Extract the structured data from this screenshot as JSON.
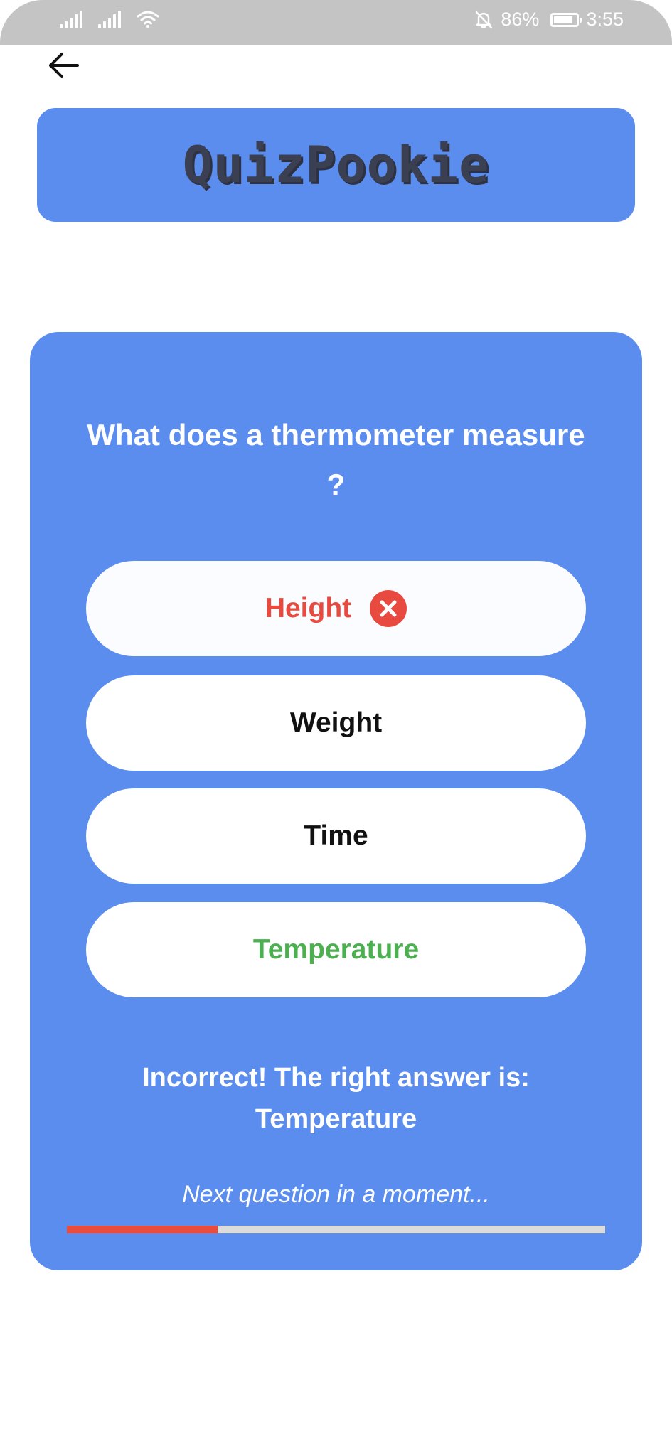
{
  "status_bar": {
    "battery_percent": "86%",
    "battery_level": 0.86,
    "time": "3:55",
    "icons": [
      "signal-1-icon",
      "signal-2-icon",
      "wifi-icon",
      "bell-off-icon",
      "battery-icon"
    ]
  },
  "header": {
    "back_icon": "arrow-left-icon",
    "app_title": "QuizPookie"
  },
  "question": {
    "text": "What does a thermometer measure ?"
  },
  "answers": [
    {
      "label": "Height",
      "state": "incorrect",
      "color": "#e84a3f",
      "icon": "wrong-icon"
    },
    {
      "label": "Weight",
      "state": "default",
      "color": "#111111"
    },
    {
      "label": "Time",
      "state": "default",
      "color": "#111111"
    },
    {
      "label": "Temperature",
      "state": "correct",
      "color": "#4caf50"
    }
  ],
  "feedback": {
    "line1": "Incorrect! The right answer is:",
    "line2": "Temperature",
    "next_message": "Next question in a moment...",
    "countdown_progress": 0.28
  },
  "colors": {
    "accent": "#5b8def",
    "wrong": "#e84a3f",
    "correct": "#4caf50",
    "progress": "#e74c3c",
    "status_bar": "#c4c4c4"
  }
}
